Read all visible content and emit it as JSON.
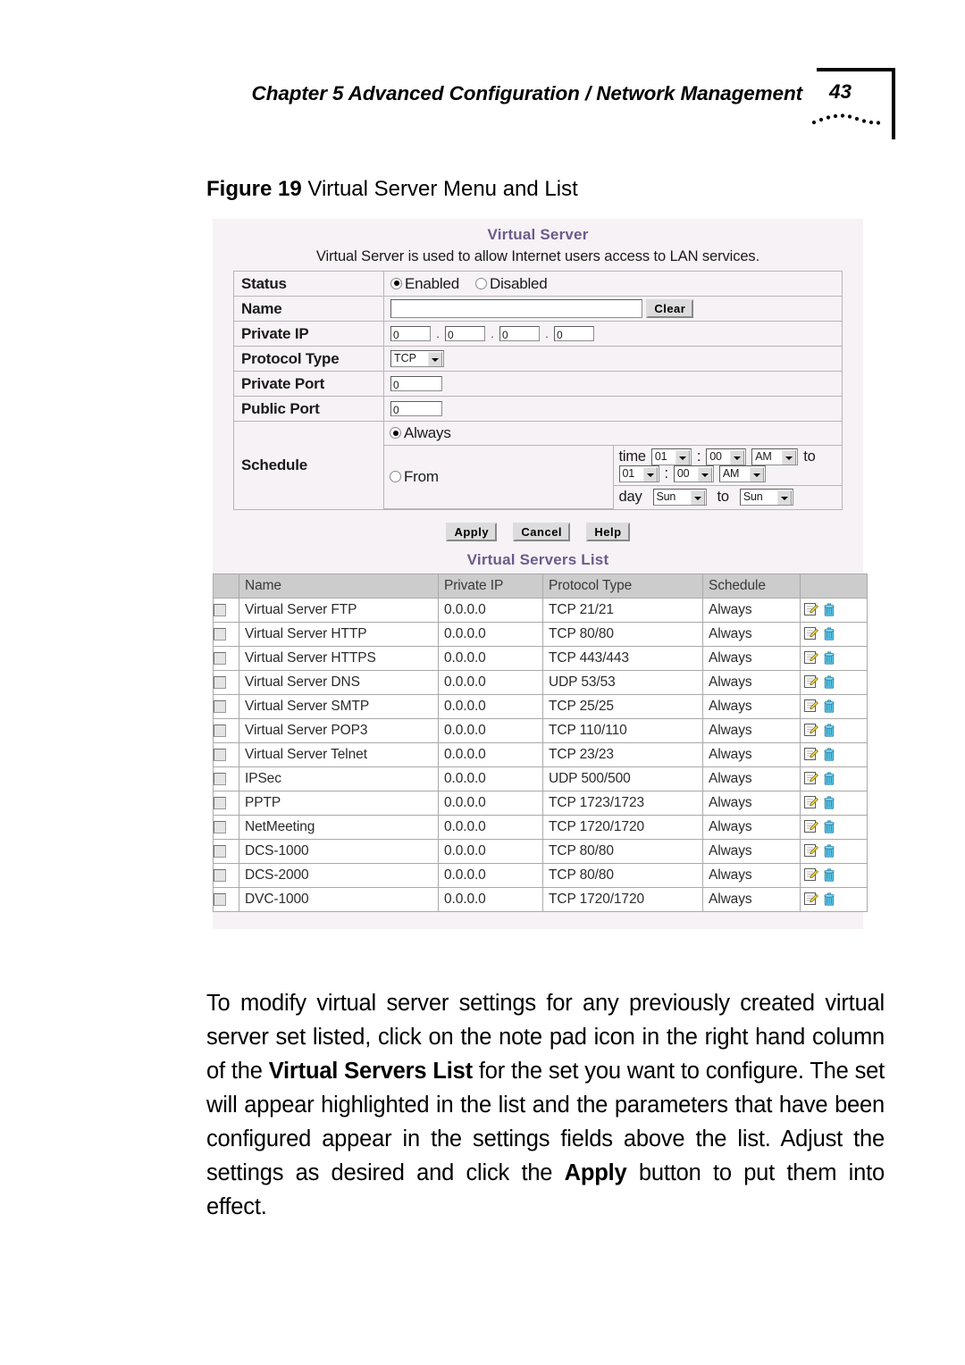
{
  "running_head": {
    "chapter_text": "Chapter 5 Advanced Configuration / Network Management",
    "page_number": "43"
  },
  "figure": {
    "label": "Figure 19",
    "caption": "Virtual Server Menu and List"
  },
  "screenshot": {
    "title": "Virtual Server",
    "description": "Virtual Server is used to allow Internet users access to LAN services.",
    "accent_color": "#6b5b8a",
    "panel_background": "#f7f2f6",
    "form": {
      "status": {
        "label": "Status",
        "enabled_label": "Enabled",
        "disabled_label": "Disabled",
        "selected": "Enabled"
      },
      "name": {
        "label": "Name",
        "value": "",
        "clear_button": "Clear"
      },
      "private_ip": {
        "label": "Private IP",
        "octets": [
          "0",
          "0",
          "0",
          "0"
        ],
        "separator": "."
      },
      "protocol_type": {
        "label": "Protocol Type",
        "value": "TCP"
      },
      "private_port": {
        "label": "Private Port",
        "value": "0"
      },
      "public_port": {
        "label": "Public Port",
        "value": "0"
      },
      "schedule": {
        "label": "Schedule",
        "always_label": "Always",
        "from_label": "From",
        "selected": "Always",
        "time_label": "time",
        "day_label": "day",
        "to_label": "to",
        "colon": ":",
        "start_hour": "01",
        "start_minute": "00",
        "start_ampm": "AM",
        "end_hour": "01",
        "end_minute": "00",
        "end_ampm": "AM",
        "start_day": "Sun",
        "end_day": "Sun"
      }
    },
    "buttons": {
      "apply": "Apply",
      "cancel": "Cancel",
      "help": "Help"
    },
    "list": {
      "title": "Virtual Servers List",
      "columns": [
        "",
        "Name",
        "Private IP",
        "Protocol Type",
        "Schedule",
        ""
      ],
      "rows": [
        {
          "name": "Virtual Server FTP",
          "private_ip": "0.0.0.0",
          "protocol": "TCP  21/21",
          "schedule": "Always"
        },
        {
          "name": "Virtual Server HTTP",
          "private_ip": "0.0.0.0",
          "protocol": "TCP  80/80",
          "schedule": "Always"
        },
        {
          "name": "Virtual Server HTTPS",
          "private_ip": "0.0.0.0",
          "protocol": "TCP  443/443",
          "schedule": "Always"
        },
        {
          "name": "Virtual Server DNS",
          "private_ip": "0.0.0.0",
          "protocol": "UDP  53/53",
          "schedule": "Always"
        },
        {
          "name": "Virtual Server SMTP",
          "private_ip": "0.0.0.0",
          "protocol": "TCP  25/25",
          "schedule": "Always"
        },
        {
          "name": "Virtual Server POP3",
          "private_ip": "0.0.0.0",
          "protocol": "TCP  110/110",
          "schedule": "Always"
        },
        {
          "name": "Virtual Server Telnet",
          "private_ip": "0.0.0.0",
          "protocol": "TCP  23/23",
          "schedule": "Always"
        },
        {
          "name": "IPSec",
          "private_ip": "0.0.0.0",
          "protocol": "UDP  500/500",
          "schedule": "Always"
        },
        {
          "name": "PPTP",
          "private_ip": "0.0.0.0",
          "protocol": "TCP  1723/1723",
          "schedule": "Always"
        },
        {
          "name": "NetMeeting",
          "private_ip": "0.0.0.0",
          "protocol": "TCP  1720/1720",
          "schedule": "Always"
        },
        {
          "name": "DCS-1000",
          "private_ip": "0.0.0.0",
          "protocol": "TCP  80/80",
          "schedule": "Always"
        },
        {
          "name": "DCS-2000",
          "private_ip": "0.0.0.0",
          "protocol": "TCP  80/80",
          "schedule": "Always"
        },
        {
          "name": "DVC-1000",
          "private_ip": "0.0.0.0",
          "protocol": "TCP  1720/1720",
          "schedule": "Always"
        }
      ]
    }
  },
  "body_paragraph": {
    "part1": "To modify virtual server settings for any previously created virtual server set listed, click on the note pad icon in the right hand column of the ",
    "bold1": "Virtual Servers List",
    "part2": " for the set you want to configure. The set will appear highlighted in the list and the parameters that have been configured appear in the settings fields above the list. Adjust the settings as desired and click the ",
    "bold2": "Apply",
    "part3": " button to put them into effect."
  }
}
